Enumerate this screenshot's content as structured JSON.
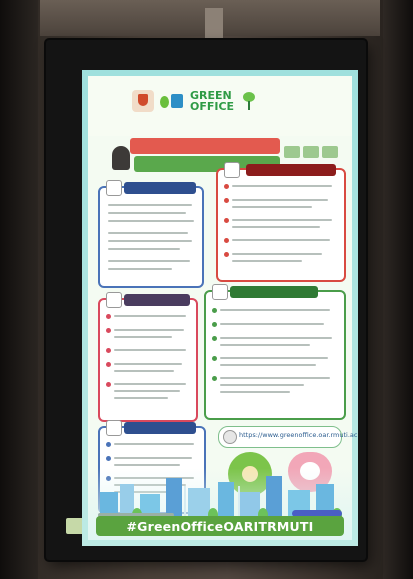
{
  "poster": {
    "logo_text_line1": "GREEN",
    "logo_text_line2": "OFFICE",
    "website_url": "https://www.greenoffice.oar.rmuti.ac.th",
    "hashtag": "#GreenOfficeOARITRMUTI"
  },
  "colors": {
    "banner_green": "#5aa33f",
    "screen_teal": "#9fe0dd"
  }
}
